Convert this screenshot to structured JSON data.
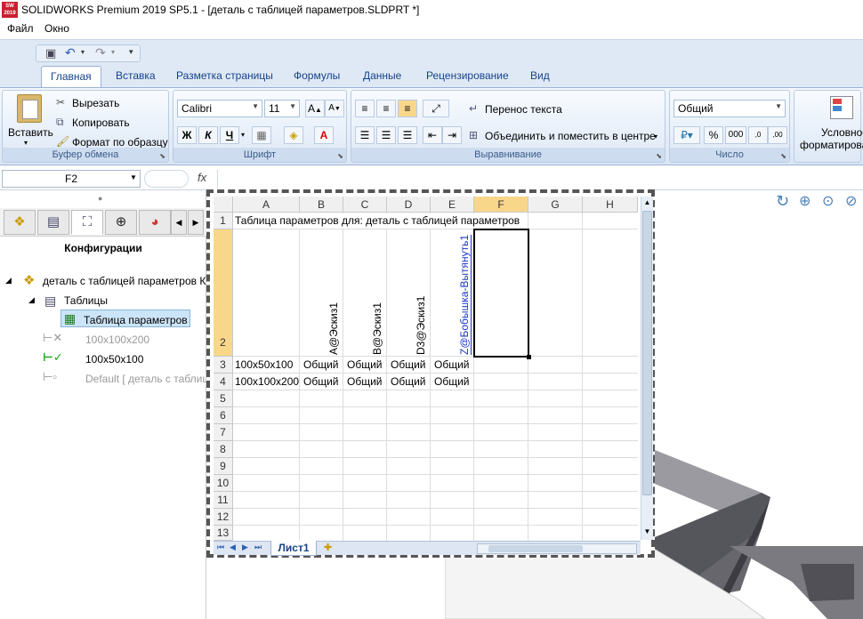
{
  "window": {
    "title": "SOLIDWORKS Premium 2019 SP5.1 - [деталь с таблицей параметров.SLDPRT *]",
    "logo_text": "SW 2019"
  },
  "menu": [
    "Файл",
    "Окно"
  ],
  "ribbon_tabs": [
    "Главная",
    "Вставка",
    "Разметка страницы",
    "Формулы",
    "Данные",
    "Рецензирование",
    "Вид"
  ],
  "clipboard": {
    "paste": "Вставить",
    "cut": "Вырезать",
    "copy": "Копировать",
    "format_painter": "Формат по образцу",
    "label": "Буфер обмена"
  },
  "font": {
    "name": "Calibri",
    "size": "11",
    "bold": "Ж",
    "italic": "К",
    "underline": "Ч",
    "label": "Шрифт"
  },
  "alignment": {
    "wrap": "Перенос текста",
    "merge": "Объединить и поместить в центре",
    "label": "Выравнивание"
  },
  "number": {
    "format": "Общий",
    "percent": "%",
    "thousands": "000",
    "label": "Число"
  },
  "styles": {
    "cond_line1": "Условное",
    "cond_line2": "форматирова"
  },
  "formula_bar": {
    "name_box": "F2",
    "fx": "fx"
  },
  "left_panel": {
    "title": "Конфигурации",
    "root": "деталь с таблицей параметров К",
    "tables": "Таблицы",
    "param_table": "Таблица параметров",
    "configs": [
      "100x100x200",
      "100x50x100",
      "Default [ деталь с таблиц"
    ]
  },
  "sheet": {
    "columns": [
      "A",
      "B",
      "C",
      "D",
      "E",
      "F",
      "G",
      "H"
    ],
    "rows": [
      "1",
      "2",
      "3",
      "4",
      "5",
      "6",
      "7",
      "8",
      "9",
      "10",
      "11",
      "12",
      "13"
    ],
    "r1": "Таблица параметров для: деталь с таблицей параметров",
    "headers": [
      "A@Эскиз1",
      "B@Эскиз1",
      "D3@Эскиз1",
      "Z@Бобышка-Вытянуть1"
    ],
    "r3": [
      "100x50x100",
      "Общий",
      "Общий",
      "Общий",
      "Общий"
    ],
    "r4": [
      "100x100x200",
      "Общий",
      "Общий",
      "Общий",
      "Общий"
    ],
    "tab": "Лист1"
  }
}
